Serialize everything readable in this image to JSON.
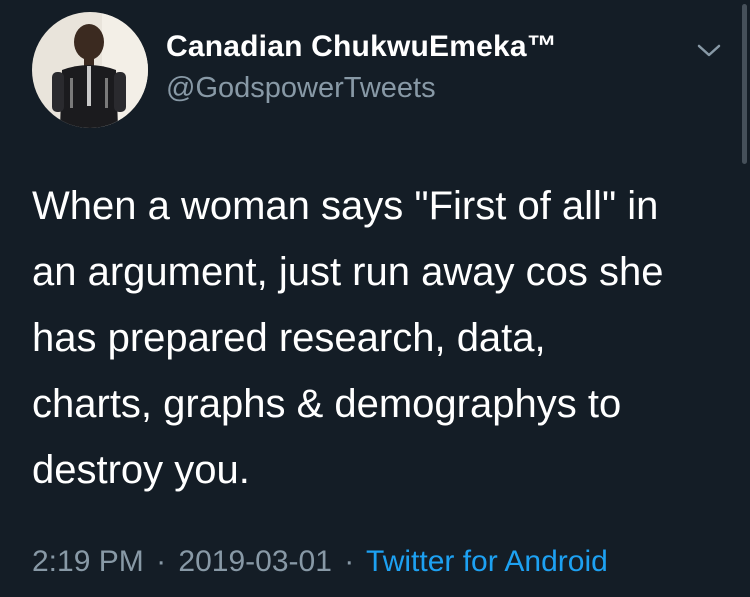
{
  "author": {
    "display_name": "Canadian ChukwuEmeka™",
    "handle": "@GodspowerTweets"
  },
  "tweet": {
    "text": "When a woman says \"First of all\" in\nan argument, just run away cos she\nhas prepared research, data,\ncharts, graphs & demographys to\ndestroy you."
  },
  "meta": {
    "time": "2:19 PM",
    "separator": "·",
    "date": "2019-03-01",
    "source": "Twitter for Android"
  },
  "icons": {
    "menu": "chevron-down-icon"
  },
  "colors": {
    "background": "#141d26",
    "secondary_text": "#8899a6",
    "link": "#1da1f2"
  }
}
